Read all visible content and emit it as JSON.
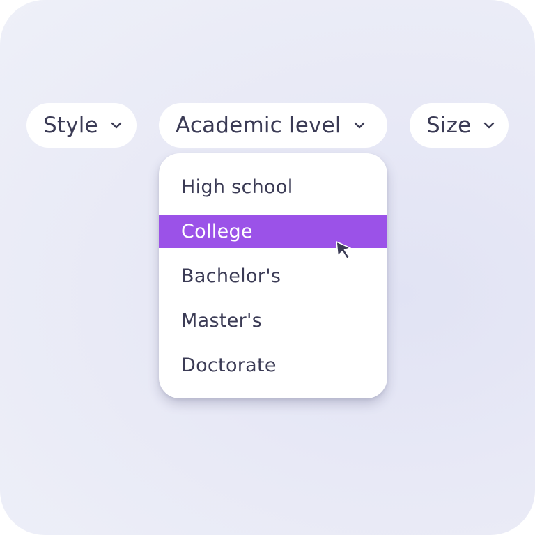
{
  "filters": {
    "style": {
      "label": "Style",
      "icon": "chevron-down-icon"
    },
    "academic_level": {
      "label": "Academic level",
      "icon": "chevron-down-icon"
    },
    "size": {
      "label": "Size",
      "icon": "chevron-down-icon"
    }
  },
  "dropdown": {
    "options": [
      {
        "label": "High school"
      },
      {
        "label": "College",
        "highlighted": true
      },
      {
        "label": "Bachelor's"
      },
      {
        "label": "Master's"
      },
      {
        "label": "Doctorate"
      }
    ]
  },
  "colors": {
    "highlight": "#9b52e8",
    "text": "#3b3b55",
    "background": "#eceef8"
  },
  "cursor": {
    "icon": "mouse-pointer-icon"
  }
}
